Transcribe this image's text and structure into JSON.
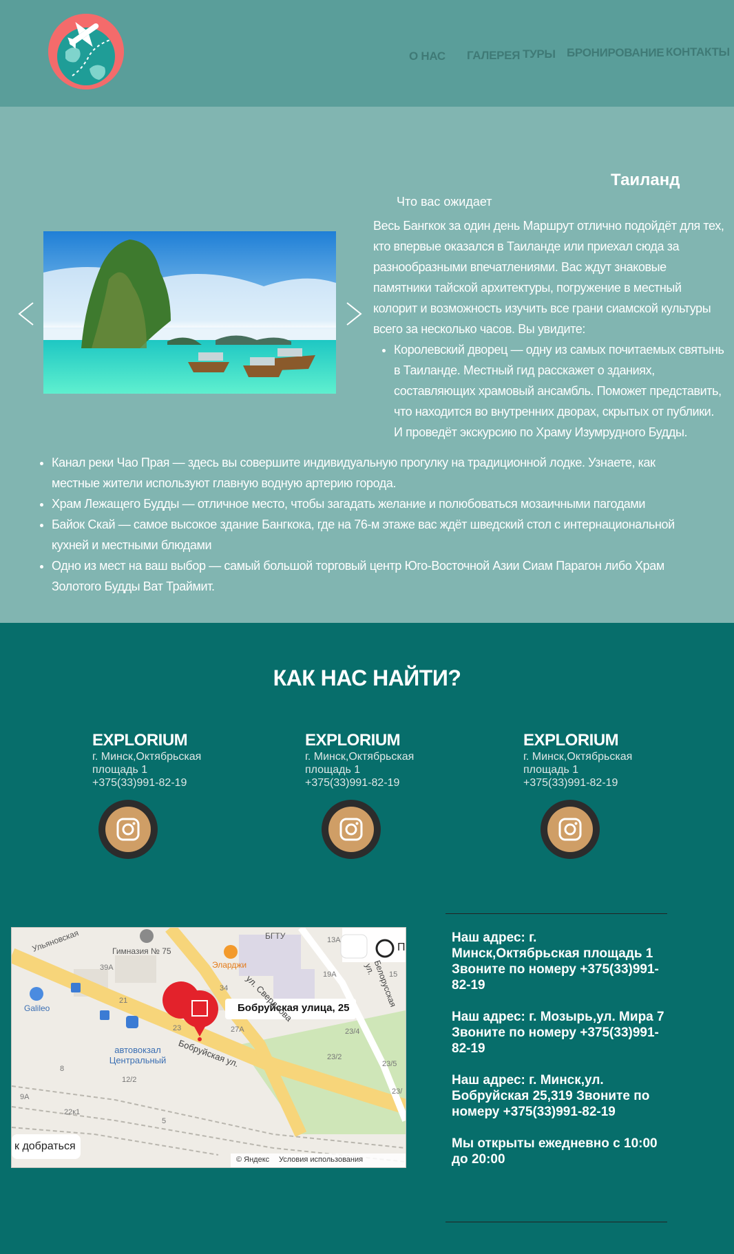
{
  "nav": {
    "items": [
      "О НАС",
      "ГАЛЕРЕЯ",
      "ТУРЫ",
      "БРОНИРОВАНИЕ",
      "КОНТАКТЫ"
    ]
  },
  "tour": {
    "title": "Таиланд",
    "expect_label": "Что вас ожидает",
    "intro": "Весь Бангкок за один день Маршрут отлично подойдёт для тех, кто впервые оказался в Таиланде или приехал сюда за разнообразными впечатлениями. Вас ждут знаковые памятники тайской архитектуры, погружение в местный колорит и возможность изучить все грани сиамской культуры всего за несколько часов. Вы увидите:",
    "bullet_1": "Королевский дворец — одну из самых почитаемых святынь в Таиланде. Местный гид расскажет о зданиях, составляющих храмовый ансамбль. Поможет представить, что находится во внутренних дворах, скрытых от публики. И проведёт экскурсию по Храму Изумрудного Будды.",
    "more_bullets": [
      "Канал реки Чао Прая — здесь вы совершите индивидуальную прогулку на традиционной лодке. Узнаете, как местные жители используют главную водную артерию города.",
      "Храм Лежащего Будды — отличное место, чтобы загадать желание и полюбоваться мозаичными пагодами",
      "Байок Скай — самое высокое здание Бангкока, где на 76-м этаже вас ждёт шведский стол с интернациональной кухней и местными блюдами",
      "Одно из мест на ваш выбор — самый большой торговый центр Юго-Восточной Азии Сиам Парагон либо Храм Золотого Будды Ват Траймит."
    ]
  },
  "find": {
    "title": "КАК НАС НАЙТИ?",
    "cards": [
      {
        "brand": "EXPLORIUM",
        "line1": "г. Минск,Октябрьская",
        "line2": "площадь 1",
        "phone": "+375(33)991-82-19"
      },
      {
        "brand": "EXPLORIUM",
        "line1": "г. Минск,Октябрьская",
        "line2": "площадь 1",
        "phone": "+375(33)991-82-19"
      },
      {
        "brand": "EXPLORIUM",
        "line1": "г. Минск,Октябрьская",
        "line2": "площадь 1",
        "phone": "+375(33)991-82-19"
      }
    ]
  },
  "map": {
    "pin_label": "Бобруйская улица, 25",
    "route_button": "к добраться",
    "layers_button": "П",
    "attribution": "© Яндекс",
    "terms": "Условия использования",
    "labels": {
      "street_1": "Ульяновская",
      "gymnasium": "Гимназия № 75",
      "bgtu": "БГТУ",
      "elarji": "Эларджи",
      "galileo": "Galileo",
      "station": "автовокзал Центральный",
      "bobr_street": "Бобруйская ул.",
      "street_2": "ул. Свердлова",
      "belorusskaya": "Белорусская ул.",
      "n39a": "39А",
      "n21": "21",
      "n23": "23",
      "n27a": "27А",
      "n34": "34",
      "n13a": "13А",
      "n19a": "19А",
      "n15": "15",
      "n23_4": "23/4",
      "n23_2": "23/2",
      "n23_5": "23/5",
      "n12_2": "12/2",
      "n8": "8",
      "n9a": "9А",
      "n22k1": "22к1",
      "n5": "5",
      "n23_short": "23/"
    }
  },
  "info": {
    "blocks": [
      "Наш адрес: г. Минск,Октябрьская площадь 1 Звоните по номеру +375(33)991-82-19",
      "Наш адрес: г. Мозырь,ул. Мира 7 Звоните по номеру +375(33)991-82-19",
      "Наш адрес: г. Минск,ул. Бобруйская 25,319 Звоните по номеру +375(33)991-82-19",
      "Мы открыты ежедневно с 10:00 до 20:00"
    ]
  },
  "colors": {
    "header_bg": "#5a9e9a",
    "section_bg": "#81b5b1",
    "footer_bg": "#076e6b",
    "instagram_accent": "#cf9e66"
  }
}
